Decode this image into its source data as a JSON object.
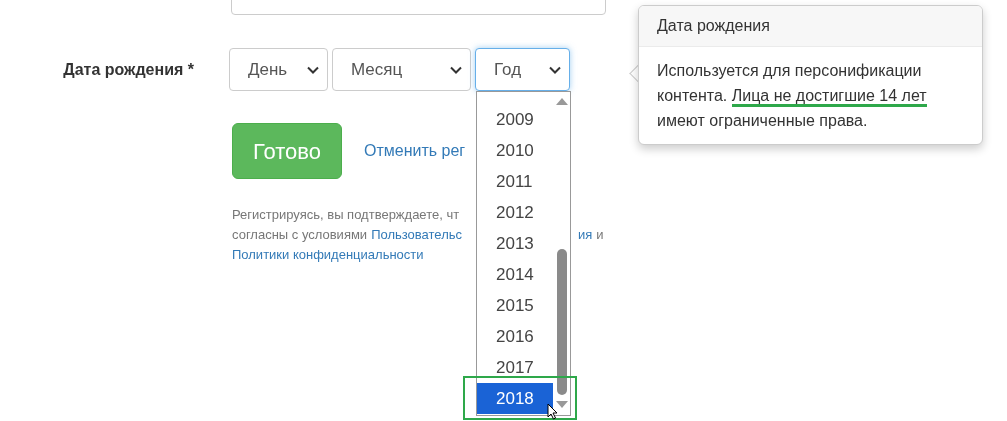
{
  "birth_row": {
    "label": "Дата рождения *",
    "selects": [
      {
        "kind": "day",
        "value": "День",
        "expanded": false
      },
      {
        "kind": "month",
        "value": "Месяц",
        "expanded": false
      },
      {
        "kind": "year",
        "value": "Год",
        "expanded": true
      }
    ]
  },
  "year_options": [
    {
      "label": "2009",
      "selected": false
    },
    {
      "label": "2010",
      "selected": false
    },
    {
      "label": "2011",
      "selected": false
    },
    {
      "label": "2012",
      "selected": false
    },
    {
      "label": "2013",
      "selected": false
    },
    {
      "label": "2014",
      "selected": false
    },
    {
      "label": "2015",
      "selected": false
    },
    {
      "label": "2016",
      "selected": false
    },
    {
      "label": "2017",
      "selected": false
    },
    {
      "label": "2018",
      "selected": true
    }
  ],
  "submit_button": "Готово",
  "cancel_link": "Отменить рег",
  "terms": {
    "line_1": "Регистрируясь, вы подтверждаете, чт",
    "line_2": "согласны с условиями",
    "link_1": "Пользовательс",
    "link_1_tail": "ия",
    "line_2_end": "и",
    "link_2": "Политики конфиденциальности"
  },
  "tooltip": {
    "title": "Дата рождения",
    "text_before": "Используется для персонификации контента. ",
    "highlight": "Лица не достигшие 14 лет",
    "text_after": " имеют ограниченные права."
  }
}
